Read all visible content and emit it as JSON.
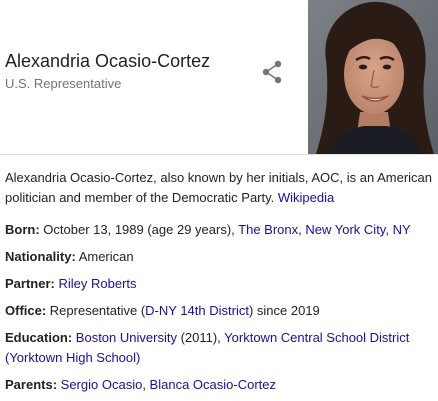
{
  "knowledge_panel": {
    "title": "Alexandria Ocasio-Cortez",
    "subtitle": "U.S. Representative",
    "share_icon": "share-icon",
    "photo_alt": "Portrait photo",
    "description": {
      "text": "Alexandria Ocasio-Cortez, also known by her initials, AOC, is an American politician and member of the Democratic Party.",
      "source_link": "Wikipedia"
    },
    "facts": {
      "born": {
        "label": "Born:",
        "text_before": " October 13, 1989 (age 29 years), ",
        "link1": "The Bronx",
        "sep": ", ",
        "link2": "New York City",
        "sep2": ", ",
        "link3": "NY"
      },
      "nationality": {
        "label": "Nationality:",
        "value": " American"
      },
      "partner": {
        "label": "Partner:",
        "sep": " ",
        "link": "Riley Roberts"
      },
      "office": {
        "label": "Office:",
        "text_before": " Representative (",
        "link": "D-NY 14th District",
        "text_after": ") since 2019"
      },
      "education": {
        "label": "Education:",
        "sep": " ",
        "link1": "Boston University",
        "text_mid": " (2011), ",
        "link2": "Yorktown Central School District (Yorktown High School)"
      },
      "parents": {
        "label": "Parents:",
        "sep": " ",
        "link1": "Sergio Ocasio",
        "sep2": ", ",
        "link2": "Blanca Ocasio-Cortez"
      }
    },
    "colors": {
      "link": "#1a0dab",
      "subtitle": "#70757a",
      "text": "#222222",
      "icon": "#70757a"
    }
  }
}
